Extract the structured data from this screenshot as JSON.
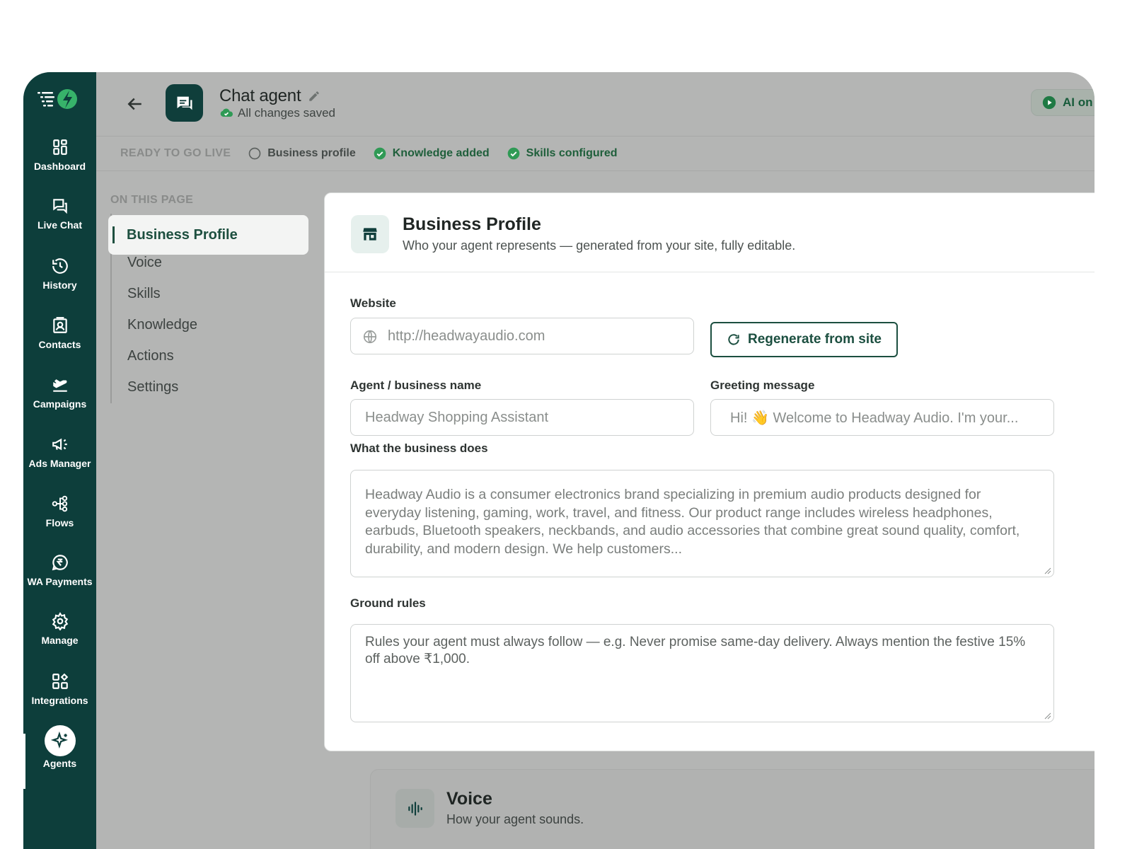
{
  "sidebar": {
    "items": [
      {
        "label": "Dashboard",
        "icon": "dashboard-icon"
      },
      {
        "label": "Live Chat",
        "icon": "chat-icon"
      },
      {
        "label": "History",
        "icon": "history-icon"
      },
      {
        "label": "Contacts",
        "icon": "contacts-icon"
      },
      {
        "label": "Campaigns",
        "icon": "campaigns-icon"
      },
      {
        "label": "Ads Manager",
        "icon": "megaphone-icon"
      },
      {
        "label": "Flows",
        "icon": "flows-icon"
      },
      {
        "label": "WA Payments",
        "icon": "rupee-icon"
      },
      {
        "label": "Manage",
        "icon": "gear-icon"
      },
      {
        "label": "Integrations",
        "icon": "integrations-icon"
      },
      {
        "label": "Agents",
        "icon": "sparkle-icon"
      }
    ],
    "active": "Agents"
  },
  "header": {
    "title": "Chat agent",
    "status": "All changes saved",
    "ai_pill": "AI on"
  },
  "readiness": {
    "label": "READY TO GO LIVE",
    "checks": [
      {
        "label": "Business profile",
        "done": false
      },
      {
        "label": "Knowledge added",
        "done": true
      },
      {
        "label": "Skills configured",
        "done": true
      }
    ]
  },
  "toc": {
    "heading": "ON THIS PAGE",
    "items": [
      "Business Profile",
      "Voice",
      "Skills",
      "Knowledge",
      "Actions",
      "Settings"
    ]
  },
  "profile": {
    "title": "Business Profile",
    "subtitle": "Who your agent represents — generated from your site, fully editable.",
    "website_label": "Website",
    "website_value": "http://headwayaudio.com",
    "regen_label": "Regenerate from site",
    "name_label": "Agent / business name",
    "name_placeholder": "Headway Shopping Assistant",
    "greeting_label": "Greeting message",
    "greeting_placeholder": "Hi! 👋 Welcome to Headway Audio. I'm your...",
    "does_label": "What the business does",
    "does_value": "Headway Audio is a consumer electronics brand specializing in premium audio products designed for everyday listening, gaming, work, travel, and fitness. Our product range includes wireless headphones, earbuds, Bluetooth speakers, neckbands, and audio accessories that combine great sound quality, comfort, durability, and modern design. We help customers...",
    "rules_label": "Ground rules",
    "rules_placeholder": "Rules your agent must always follow — e.g. Never promise same-day delivery. Always mention the festive 15% off above ₹1,000."
  },
  "voice": {
    "title": "Voice",
    "subtitle": "How your agent sounds."
  },
  "colors": {
    "sidebar": "#0d3e3b",
    "accent": "#1c4f40",
    "success": "#2f9a55"
  }
}
